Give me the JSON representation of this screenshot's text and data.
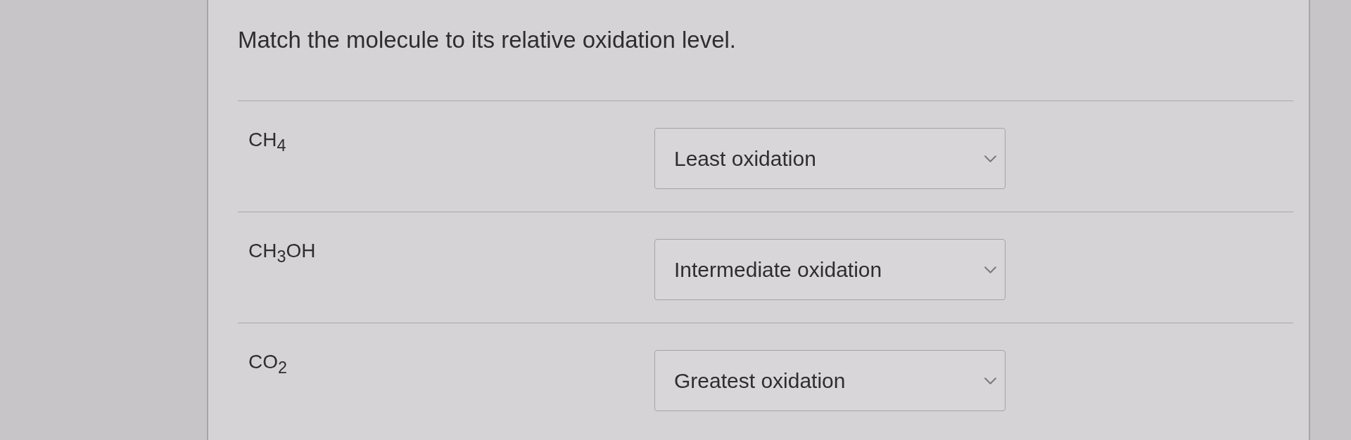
{
  "question": {
    "prompt": "Match the molecule to its relative oxidation level."
  },
  "pairs": [
    {
      "molecule": "CH$_{4}$",
      "answer": "Least oxidation"
    },
    {
      "molecule": "CH$_{3}$OH",
      "answer": "Intermediate oxidation"
    },
    {
      "molecule": "CO$_{2}$",
      "answer": "Greatest oxidation"
    }
  ]
}
